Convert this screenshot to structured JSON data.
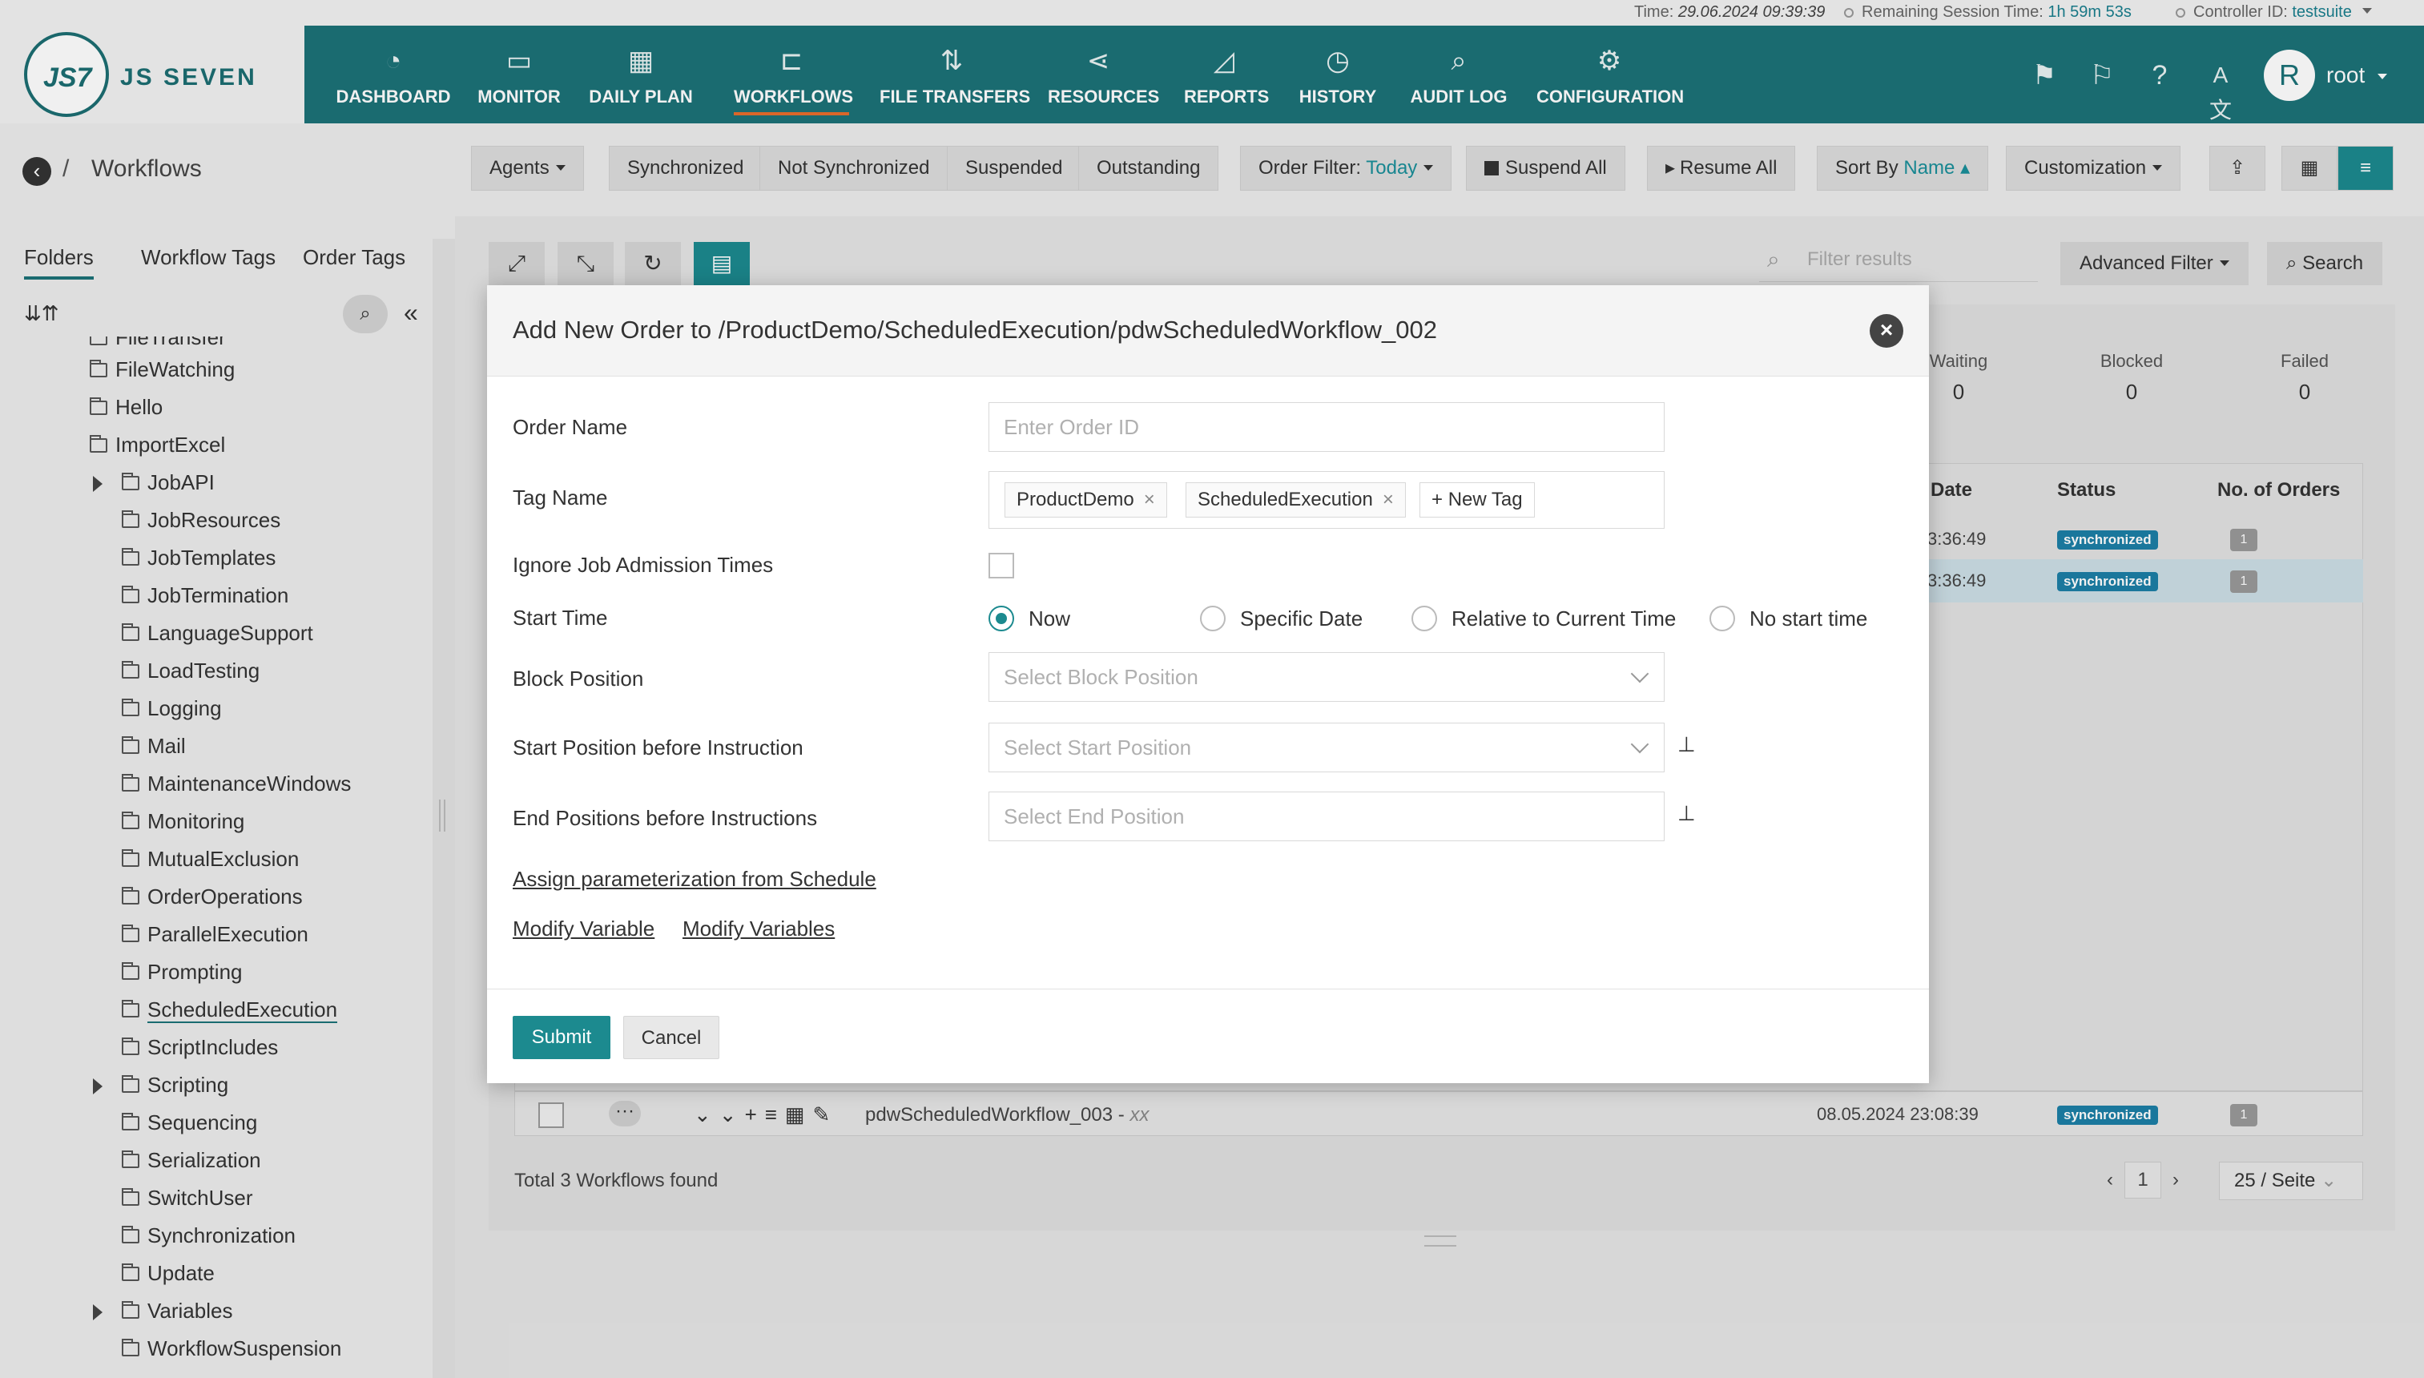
{
  "status": {
    "time_label": "Time:",
    "time_value": "29.06.2024 09:39:39",
    "session_label": "Remaining Session Time:",
    "session_value": "1h 59m 53s",
    "controller_label": "Controller ID:",
    "controller_value": "testsuite"
  },
  "logo": {
    "mark": "JS7",
    "text": "JS SEVEN"
  },
  "nav": [
    {
      "label": "DASHBOARD",
      "icon": "dashboard-icon",
      "glyph": "◔"
    },
    {
      "label": "MONITOR",
      "icon": "monitor-icon",
      "glyph": "▭"
    },
    {
      "label": "DAILY PLAN",
      "icon": "calendar-icon",
      "glyph": "▦"
    },
    {
      "label": "WORKFLOWS",
      "icon": "workflow-icon",
      "glyph": "⊏"
    },
    {
      "label": "FILE TRANSFERS",
      "icon": "transfer-icon",
      "glyph": "⇅"
    },
    {
      "label": "RESOURCES",
      "icon": "share-icon",
      "glyph": "⋖"
    },
    {
      "label": "REPORTS",
      "icon": "chart-icon",
      "glyph": "◿"
    },
    {
      "label": "HISTORY",
      "icon": "clock-icon",
      "glyph": "◷"
    },
    {
      "label": "AUDIT LOG",
      "icon": "audit-icon",
      "glyph": "⌕"
    },
    {
      "label": "CONFIGURATION",
      "icon": "gear-icon",
      "glyph": "⚙"
    }
  ],
  "user": {
    "initial": "R",
    "name": "root"
  },
  "breadcrumb": {
    "sep": "/",
    "title": "Workflows"
  },
  "toolbar": {
    "agents": "Agents",
    "synchronized": "Synchronized",
    "not_synchronized": "Not Synchronized",
    "suspended": "Suspended",
    "outstanding": "Outstanding",
    "order_filter_label": "Order Filter:",
    "order_filter_value": "Today",
    "suspend_all": "Suspend All",
    "resume_all": "Resume All",
    "sort_label": "Sort By",
    "sort_value": "Name",
    "customization": "Customization"
  },
  "left_tabs": [
    "Folders",
    "Workflow Tags",
    "Order Tags"
  ],
  "tree": [
    {
      "label": "FileTransfer",
      "expandable": false
    },
    {
      "label": "FileWatching",
      "expandable": false
    },
    {
      "label": "Hello",
      "expandable": false
    },
    {
      "label": "ImportExcel",
      "expandable": false
    },
    {
      "label": "JobAPI",
      "expandable": true
    },
    {
      "label": "JobResources",
      "expandable": false
    },
    {
      "label": "JobTemplates",
      "expandable": false
    },
    {
      "label": "JobTermination",
      "expandable": false
    },
    {
      "label": "LanguageSupport",
      "expandable": false
    },
    {
      "label": "LoadTesting",
      "expandable": false
    },
    {
      "label": "Logging",
      "expandable": false
    },
    {
      "label": "Mail",
      "expandable": false
    },
    {
      "label": "MaintenanceWindows",
      "expandable": false
    },
    {
      "label": "Monitoring",
      "expandable": false
    },
    {
      "label": "MutualExclusion",
      "expandable": false
    },
    {
      "label": "OrderOperations",
      "expandable": false
    },
    {
      "label": "ParallelExecution",
      "expandable": false
    },
    {
      "label": "Prompting",
      "expandable": false
    },
    {
      "label": "ScheduledExecution",
      "expandable": false,
      "active": true
    },
    {
      "label": "ScriptIncludes",
      "expandable": false
    },
    {
      "label": "Scripting",
      "expandable": true
    },
    {
      "label": "Sequencing",
      "expandable": false
    },
    {
      "label": "Serialization",
      "expandable": false
    },
    {
      "label": "SwitchUser",
      "expandable": false
    },
    {
      "label": "Synchronization",
      "expandable": false
    },
    {
      "label": "Update",
      "expandable": false
    },
    {
      "label": "Variables",
      "expandable": true
    },
    {
      "label": "WorkflowSuspension",
      "expandable": false
    }
  ],
  "main": {
    "filter_placeholder": "Filter results",
    "advanced_filter": "Advanced Filter",
    "search": "Search",
    "stats": [
      {
        "label": "Waiting",
        "value": "0"
      },
      {
        "label": "Blocked",
        "value": "0"
      },
      {
        "label": "Failed",
        "value": "0"
      }
    ],
    "columns": {
      "date": "Date",
      "status": "Status",
      "orders": "No. of Orders"
    },
    "rows": [
      {
        "time": "3:36:49",
        "status": "synchronized",
        "orders": "1"
      },
      {
        "time": "3:36:49",
        "status": "synchronized",
        "orders": "1"
      }
    ],
    "row3": {
      "name": "pdwScheduledWorkflow_003",
      "sep": "-",
      "extra": "xx",
      "date": "08.05.2024 23:08:39",
      "status": "synchronized",
      "orders": "1"
    },
    "total": "Total 3 Workflows found",
    "page": "1",
    "per_page": "25 / Seite"
  },
  "modal": {
    "title": "Add New Order to /ProductDemo/ScheduledExecution/pdwScheduledWorkflow_002",
    "order_name_label": "Order Name",
    "order_name_placeholder": "Enter Order ID",
    "tag_name_label": "Tag Name",
    "tags": [
      "ProductDemo",
      "ScheduledExecution"
    ],
    "new_tag": "New Tag",
    "ignore_label": "Ignore Job Admission Times",
    "start_time_label": "Start Time",
    "start_options": [
      "Now",
      "Specific Date",
      "Relative to Current Time",
      "No start time"
    ],
    "start_selected": "Now",
    "block_label": "Block Position",
    "block_placeholder": "Select Block Position",
    "start_pos_label": "Start Position before Instruction",
    "start_pos_placeholder": "Select Start Position",
    "end_pos_label": "End Positions before Instructions",
    "end_pos_placeholder": "Select End Position",
    "assign_link": "Assign parameterization from Schedule",
    "modify_variable": "Modify Variable",
    "modify_variables": "Modify Variables",
    "submit": "Submit",
    "cancel": "Cancel"
  }
}
